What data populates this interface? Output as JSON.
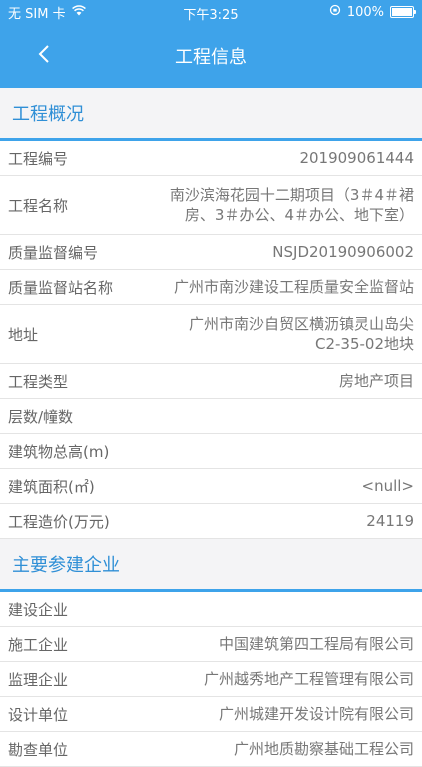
{
  "statusbar": {
    "carrier": "无 SIM 卡",
    "time": "下午3:25",
    "battery": "100%"
  },
  "navbar": {
    "title": "工程信息"
  },
  "overview": {
    "title": "工程概况",
    "rows": [
      {
        "label": "工程编号",
        "value": "201909061444"
      },
      {
        "label": "工程名称",
        "value": "南沙滨海花园十二期项目（3＃4＃裙房、3＃办公、4＃办公、地下室）"
      },
      {
        "label": "质量监督编号",
        "value": "NSJD20190906002"
      },
      {
        "label": "质量监督站名称",
        "value": "广州市南沙建设工程质量安全监督站"
      },
      {
        "label": "地址",
        "value": "广州市南沙自贸区横沥镇灵山岛尖C2-35-02地块"
      },
      {
        "label": "工程类型",
        "value": "房地产项目"
      },
      {
        "label": "层数/幢数",
        "value": ""
      },
      {
        "label": "建筑物总高(m)",
        "value": ""
      },
      {
        "label": "建筑面积(㎡)",
        "value": "<null>"
      },
      {
        "label": "工程造价(万元)",
        "value": "24119"
      }
    ]
  },
  "companies": {
    "title": "主要参建企业",
    "rows": [
      {
        "label": "建设企业",
        "value": ""
      },
      {
        "label": "施工企业",
        "value": "中国建筑第四工程局有限公司"
      },
      {
        "label": "监理企业",
        "value": "广州越秀地产工程管理有限公司"
      },
      {
        "label": "设计单位",
        "value": "广州城建开发设计院有限公司"
      },
      {
        "label": "勘查单位",
        "value": "广州地质勘察基础工程公司"
      }
    ]
  }
}
